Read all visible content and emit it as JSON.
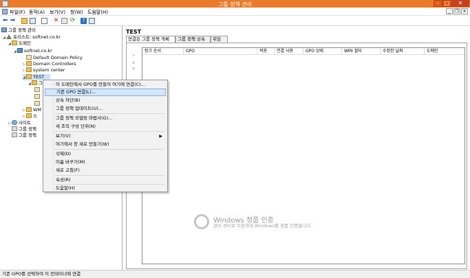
{
  "window": {
    "title": "그룹 정책 관리",
    "minimize": "–",
    "maximize": "□",
    "close": "✕"
  },
  "menubar": {
    "items": [
      "파일(F)",
      "동작(A)",
      "보기(V)",
      "창(W)",
      "도움말(H)"
    ],
    "mdi": [
      "_",
      "❐",
      "✕"
    ]
  },
  "toolbar": {
    "icons": [
      "back-arrow-icon",
      "forward-arrow-icon",
      "folder-up-icon",
      "show-tree-icon",
      "properties-icon",
      "delete-icon",
      "export-icon",
      "refresh-icon",
      "help-icon",
      "console-icon"
    ]
  },
  "tree": {
    "root": "그룹 정책 관리",
    "forest": "포리스트: softnet.co.kr",
    "domains": "도메인",
    "domain": "softnet.co.kr",
    "items": [
      "Default Domain Policy",
      "Domain Controllers",
      "system center",
      "TEST"
    ],
    "partial_items": [
      "그",
      "",
      "",
      "",
      "WM",
      "스"
    ],
    "sites": "사이트",
    "modeling": "그룹 정책",
    "results": "그룹 정책"
  },
  "right": {
    "title": "TEST",
    "tabs": [
      "연결된 그룹 정책 개체",
      "그룹 정책 상속",
      "위임"
    ],
    "columns": [
      "링크 순서",
      "GPO",
      "적용",
      "연결 사용",
      "GPO 상태",
      "WMI 필터",
      "수정한 날짜",
      "도메인"
    ]
  },
  "context_menu": {
    "items": [
      {
        "label": "이 도메인에서 GPO를 만들어 여기에 연결(C)..."
      },
      {
        "label": "기존 GPO 연결(L)...",
        "highlighted": true
      },
      {
        "label": "상속 차단(B)"
      },
      {
        "label": "그룹 정책 업데이트(U)..."
      },
      {
        "label": "그룹 정책 모델링 마법사(G)..."
      },
      {
        "label": "새 조직 구성 단위(N)"
      },
      {
        "label": "보기(V)",
        "submenu": true
      },
      {
        "label": "여기에서 창 새로 만들기(W)"
      },
      {
        "label": "삭제(D)"
      },
      {
        "label": "이름 바꾸기(M)"
      },
      {
        "label": "새로 고침(F)"
      },
      {
        "label": "속성(R)"
      },
      {
        "label": "도움말(H)"
      }
    ],
    "submenu_arrow": "▶"
  },
  "watermark": {
    "title": "Windows 정품 인증",
    "subtitle": "관리 센터로 이동하여 Windows를 정품 인증합니다."
  },
  "status": {
    "text": "기존 GPO를 선택하여 이 컨테이너에 연결"
  },
  "colors": {
    "titlebar": "#ec7a2b",
    "highlight": "#d4e6f7"
  }
}
